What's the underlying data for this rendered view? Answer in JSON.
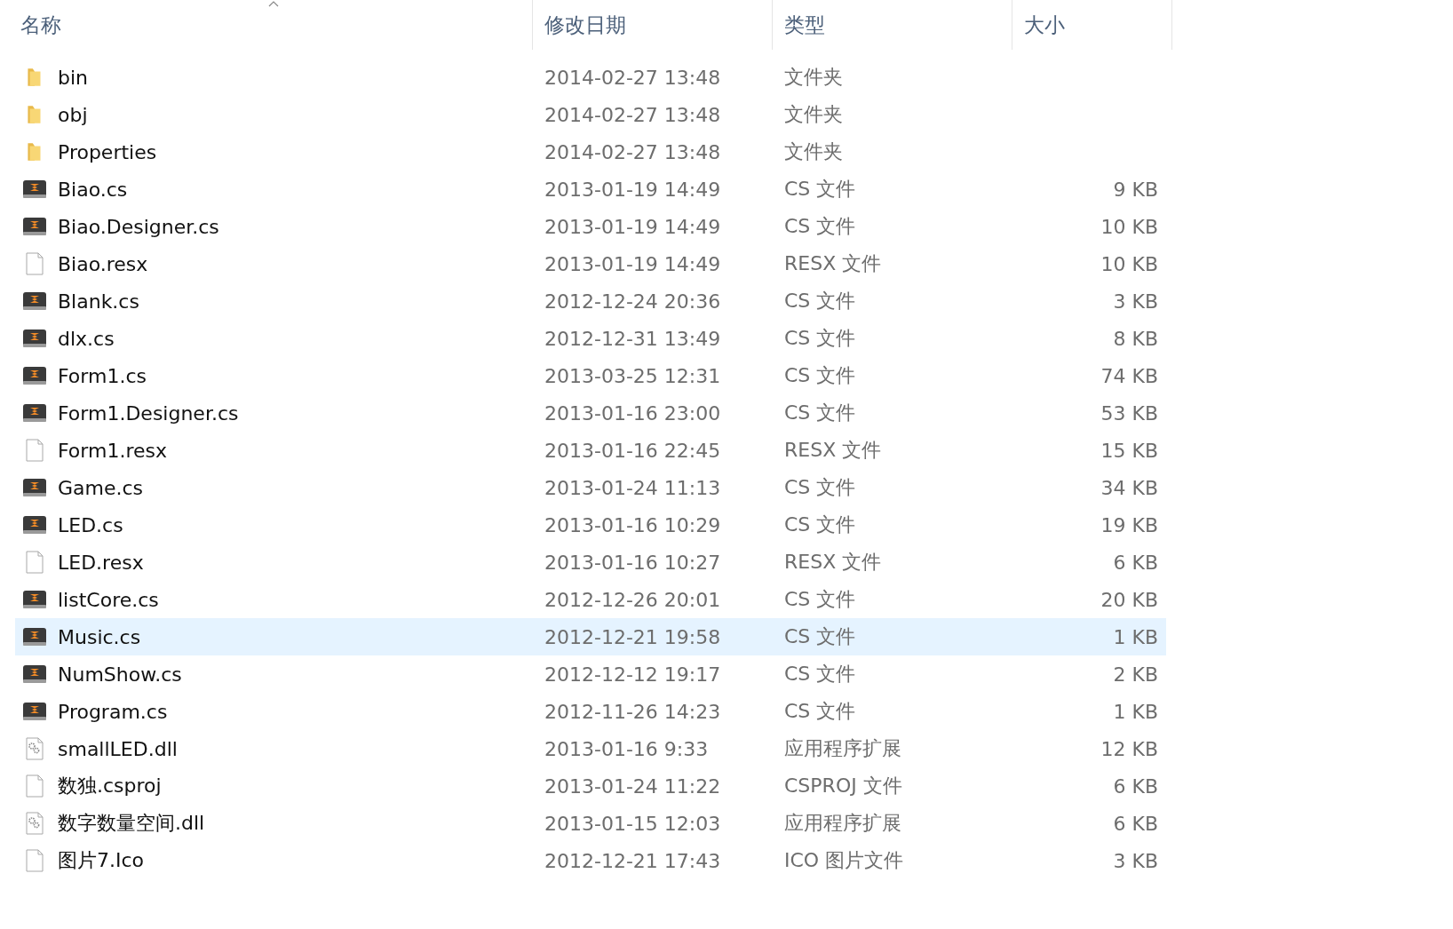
{
  "columns": [
    {
      "label": "名称",
      "sorted": true
    },
    {
      "label": "修改日期",
      "sorted": false
    },
    {
      "label": "类型",
      "sorted": false
    },
    {
      "label": "大小",
      "sorted": false
    }
  ],
  "rows": [
    {
      "kind": "folder",
      "name": "bin",
      "date": "2014-02-27 13:48",
      "type": "文件夹",
      "selected": false
    },
    {
      "kind": "folder",
      "name": "obj",
      "date": "2014-02-27 13:48",
      "type": "文件夹",
      "selected": false
    },
    {
      "kind": "folder",
      "name": "Properties",
      "date": "2014-02-27 13:48",
      "type": "文件夹",
      "selected": false
    },
    {
      "kind": "code",
      "name": "Biao.cs",
      "date": "2013-01-19 14:49",
      "type": "CS 文件",
      "size": "9 KB",
      "selected": false
    },
    {
      "kind": "code",
      "name": "Biao.Designer.cs",
      "date": "2013-01-19 14:49",
      "type": "CS 文件",
      "size": "10 KB",
      "selected": false
    },
    {
      "kind": "blank",
      "name": "Biao.resx",
      "date": "2013-01-19 14:49",
      "type": "RESX 文件",
      "size": "10 KB",
      "selected": false
    },
    {
      "kind": "code",
      "name": "Blank.cs",
      "date": "2012-12-24 20:36",
      "type": "CS 文件",
      "size": "3 KB",
      "selected": false
    },
    {
      "kind": "code",
      "name": "dlx.cs",
      "date": "2012-12-31 13:49",
      "type": "CS 文件",
      "size": "8 KB",
      "selected": false
    },
    {
      "kind": "code",
      "name": "Form1.cs",
      "date": "2013-03-25 12:31",
      "type": "CS 文件",
      "size": "74 KB",
      "selected": false
    },
    {
      "kind": "code",
      "name": "Form1.Designer.cs",
      "date": "2013-01-16 23:00",
      "type": "CS 文件",
      "size": "53 KB",
      "selected": false
    },
    {
      "kind": "blank",
      "name": "Form1.resx",
      "date": "2013-01-16 22:45",
      "type": "RESX 文件",
      "size": "15 KB",
      "selected": false
    },
    {
      "kind": "code",
      "name": "Game.cs",
      "date": "2013-01-24 11:13",
      "type": "CS 文件",
      "size": "34 KB",
      "selected": false
    },
    {
      "kind": "code",
      "name": "LED.cs",
      "date": "2013-01-16 10:29",
      "type": "CS 文件",
      "size": "19 KB",
      "selected": false
    },
    {
      "kind": "blank",
      "name": "LED.resx",
      "date": "2013-01-16 10:27",
      "type": "RESX 文件",
      "size": "6 KB",
      "selected": false
    },
    {
      "kind": "code",
      "name": "listCore.cs",
      "date": "2012-12-26 20:01",
      "type": "CS 文件",
      "size": "20 KB",
      "selected": false
    },
    {
      "kind": "code",
      "name": "Music.cs",
      "date": "2012-12-21 19:58",
      "type": "CS 文件",
      "size": "1 KB",
      "selected": true
    },
    {
      "kind": "code",
      "name": "NumShow.cs",
      "date": "2012-12-12 19:17",
      "type": "CS 文件",
      "size": "2 KB",
      "selected": false
    },
    {
      "kind": "code",
      "name": "Program.cs",
      "date": "2012-11-26 14:23",
      "type": "CS 文件",
      "size": "1 KB",
      "selected": false
    },
    {
      "kind": "library",
      "name": "smallLED.dll",
      "date": "2013-01-16 9:33",
      "type": "应用程序扩展",
      "size": "12 KB",
      "selected": false
    },
    {
      "kind": "blank",
      "name": "数独.csproj",
      "date": "2013-01-24 11:22",
      "type": "CSPROJ 文件",
      "size": "6 KB",
      "selected": false
    },
    {
      "kind": "library",
      "name": "数字数量空间.dll",
      "date": "2013-01-15 12:03",
      "type": "应用程序扩展",
      "size": "6 KB",
      "selected": false
    },
    {
      "kind": "blank",
      "name": "图片7.Ico",
      "date": "2012-12-21 17:43",
      "type": "ICO 图片文件",
      "size": "3 KB",
      "selected": false
    }
  ]
}
